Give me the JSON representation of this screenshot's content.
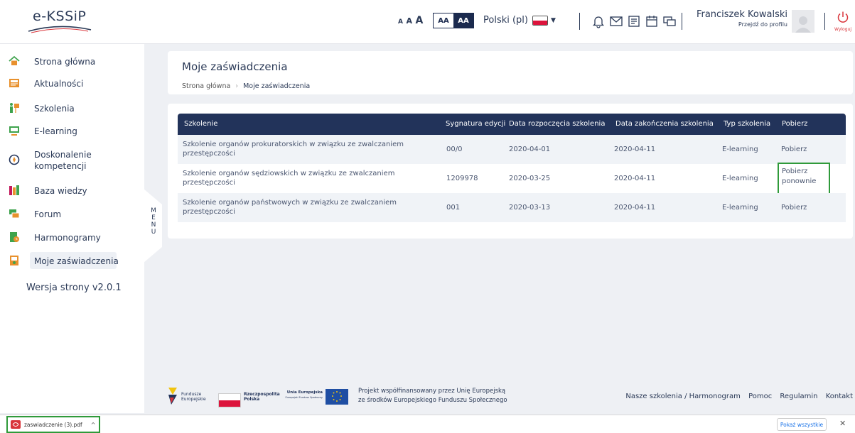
{
  "header": {
    "logo": "e-KSSiP",
    "font_size_options": [
      "A",
      "A",
      "A"
    ],
    "contrast_options": [
      "AA",
      "AA"
    ],
    "language": "Polski (pl)",
    "user_name": "Franciszek Kowalski",
    "profile_link": "Przejdź do profilu",
    "logout_label": "Wyloguj"
  },
  "sidebar": {
    "items": [
      {
        "label": "Strona główna",
        "icon": "home-icon"
      },
      {
        "label": "Aktualności",
        "icon": "news-icon"
      },
      {
        "label": "Szkolenia",
        "icon": "training-icon"
      },
      {
        "label": "E-learning",
        "icon": "elearning-icon"
      },
      {
        "label": "Doskonalenie\nkompetencji",
        "icon": "compass-icon"
      },
      {
        "label": "Baza wiedzy",
        "icon": "books-icon"
      },
      {
        "label": "Forum",
        "icon": "forum-icon"
      },
      {
        "label": "Harmonogramy",
        "icon": "schedule-icon"
      },
      {
        "label": "Moje zaświadczenia",
        "icon": "certificate-icon"
      }
    ],
    "version": "Wersja strony v2.0.1",
    "menu_toggle": "MENU"
  },
  "page": {
    "title": "Moje zaświadczenia",
    "breadcrumb": [
      "Strona główna",
      "Moje zaświadczenia"
    ]
  },
  "table": {
    "headers": [
      "Szkolenie",
      "Sygnatura edycji",
      "Data rozpoczęcia szkolenia",
      "Data zakończenia szkolenia",
      "Typ szkolenia",
      "Pobierz"
    ],
    "rows": [
      {
        "name": "Szkolenie organów prokuratorskich w związku ze zwalczaniem przestępczości",
        "signature": "00/0",
        "start": "2020-04-01",
        "end": "2020-04-11",
        "type": "E-learning",
        "download": "Pobierz"
      },
      {
        "name": "Szkolenie organów sędziowskich w związku ze zwalczaniem przestępczości",
        "signature": "1209978",
        "start": "2020-03-25",
        "end": "2020-04-11",
        "type": "E-learning",
        "download": "Pobierz ponownie"
      },
      {
        "name": "Szkolenie organów państwowych w związku ze zwalczaniem przestępczości",
        "signature": "001",
        "start": "2020-03-13",
        "end": "2020-04-11",
        "type": "E-learning",
        "download": "Pobierz"
      }
    ]
  },
  "footer": {
    "logos": [
      {
        "line1": "Fundusze",
        "line2": "Europejskie"
      },
      {
        "line1": "Rzeczpospolita",
        "line2": "Polska"
      },
      {
        "line1": "Unia Europejska",
        "line2": "Europejski Fundusz Społeczny"
      }
    ],
    "project_text": [
      "Projekt współfinansowany przez Unię Europejską",
      "ze środków Europejskiego Funduszu Społecznego"
    ],
    "links": [
      "Nasze szkolenia / Harmonogram",
      "Pomoc",
      "Regulamin",
      "Kontakt"
    ]
  },
  "download_bar": {
    "file_name": "zaswiadczenie (3).pdf",
    "show_all": "Pokaż wszystkie"
  },
  "colors": {
    "navy": "#22335a",
    "highlight": "#2f9a3a",
    "logout": "#d9343a",
    "icon_green": "#3fa34d",
    "icon_orange": "#e8912d"
  }
}
